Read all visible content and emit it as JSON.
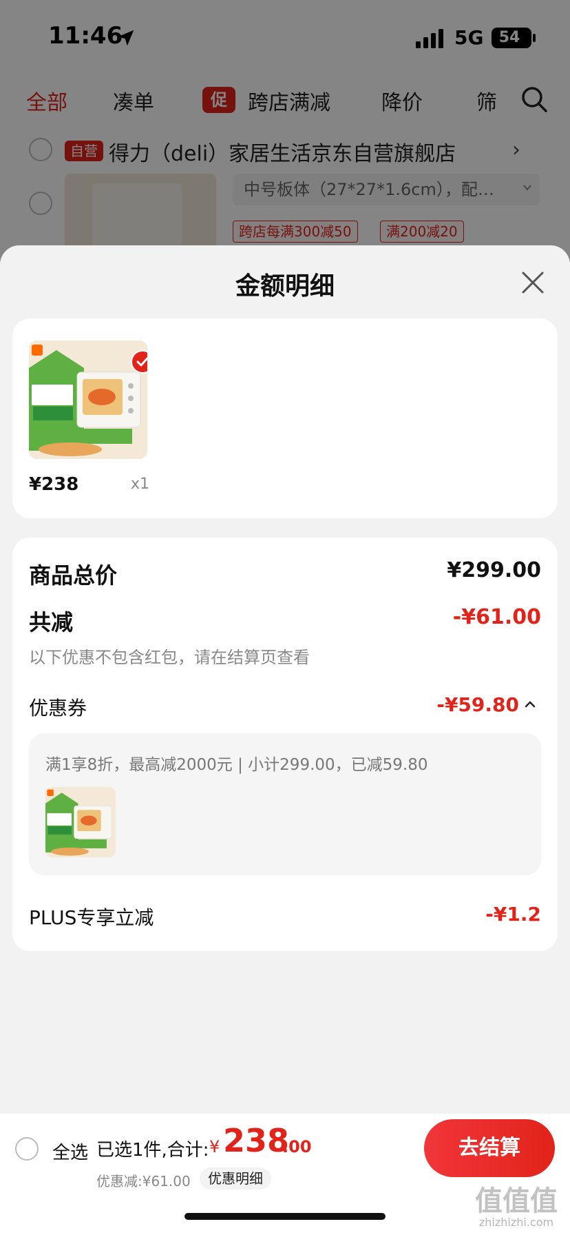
{
  "status_bar": {
    "time": "11:46",
    "network": "5G",
    "battery": "54"
  },
  "tabs": [
    {
      "label": "全部",
      "active": true
    },
    {
      "label": "凑单",
      "active": false
    },
    {
      "label": "跨店满减",
      "active": false,
      "badge": "促"
    },
    {
      "label": "降价",
      "active": false
    },
    {
      "label": "筛",
      "active": false
    }
  ],
  "store": {
    "badge": "自营",
    "name": "得力（deli）家居生活京东自营旗舰店",
    "chevron": "›"
  },
  "background_product": {
    "spec": "中号板体（27*27*1.6cm），配…",
    "promo_tags": [
      "跨店每满300减50",
      "满200减20"
    ]
  },
  "sheet": {
    "title": "金额明细",
    "item": {
      "price": "¥238",
      "qty": "x1"
    },
    "details": {
      "goods_total_label": "商品总价",
      "goods_total_value": "¥299.00",
      "total_discount_label": "共减",
      "total_discount_value": "-¥61.00",
      "note": "以下优惠不包含红包，请在结算页查看",
      "coupon_label": "优惠券",
      "coupon_value": "-¥59.80",
      "coupon_desc": "满1享8折，最高减2000元 | 小计299.00，已减59.80",
      "plus_label": "PLUS专享立减",
      "plus_value": "-¥1.2"
    }
  },
  "checkout": {
    "select_all": "全选",
    "selected_summary": "已选1件,合计:",
    "currency": "¥",
    "total_main": "238",
    "total_decimal": ".00",
    "saved": "优惠减:¥61.00",
    "detail_link": "优惠明细",
    "button": "去结算"
  },
  "watermark": {
    "mark": "值值值",
    "domain": "zhizhizhi.com"
  },
  "colors": {
    "accent": "#e2231a",
    "sheet_bg": "#f2f2f2",
    "card_bg": "#ffffff"
  }
}
